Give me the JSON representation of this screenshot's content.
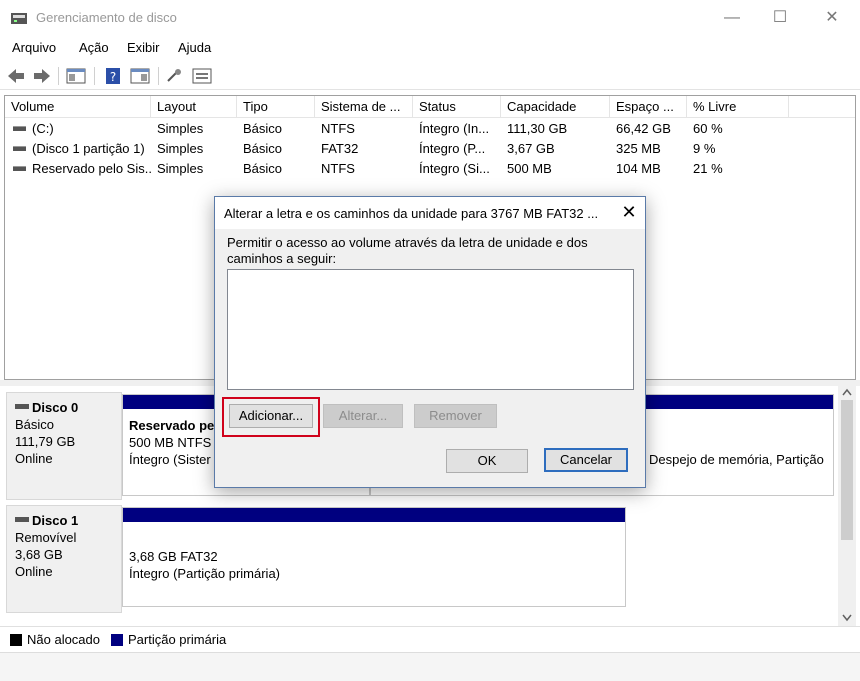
{
  "window": {
    "title": "Gerenciamento de disco",
    "minimize": "—",
    "maximize": "☐",
    "close": "✕"
  },
  "menu": [
    "Arquivo",
    "Ação",
    "Exibir",
    "Ajuda"
  ],
  "volumes": {
    "columns": [
      "Volume",
      "Layout",
      "Tipo",
      "Sistema de ...",
      "Status",
      "Capacidade",
      "Espaço ...",
      "% Livre"
    ],
    "rows": [
      [
        "(C:)",
        "Simples",
        "Básico",
        "NTFS",
        "Íntegro (In...",
        "111,30 GB",
        "66,42 GB",
        "60 %"
      ],
      [
        "(Disco 1 partição 1)",
        "Simples",
        "Básico",
        "FAT32",
        "Íntegro (P...",
        "3,67 GB",
        "325 MB",
        "9 %"
      ],
      [
        "Reservado pelo Sis...",
        "Simples",
        "Básico",
        "NTFS",
        "Íntegro (Si...",
        "500 MB",
        "104 MB",
        "21 %"
      ]
    ]
  },
  "disks": [
    {
      "name": "Disco 0",
      "type": "Básico",
      "size": "111,79 GB",
      "state": "Online",
      "partitions": [
        {
          "title": "Reservado pe",
          "line1": "500 MB NTFS",
          "line2": "Íntegro (Sister"
        },
        {
          "title": "",
          "line1": "",
          "line2": "Despejo de memória, Partição"
        }
      ]
    },
    {
      "name": "Disco 1",
      "type": "Removível",
      "size": "3,68 GB",
      "state": "Online",
      "partitions": [
        {
          "title": "",
          "line1": "3,68 GB FAT32",
          "line2": "Íntegro (Partição primária)"
        }
      ]
    }
  ],
  "legend": [
    {
      "label": "Não alocado",
      "color": "#000000"
    },
    {
      "label": "Partição primária",
      "color": "#000080"
    }
  ],
  "dialog": {
    "title": "Alterar a letra e os caminhos da unidade para 3767 MB FAT32 ...",
    "close": "✕",
    "description": "Permitir o acesso ao volume através da letra de unidade e dos caminhos a seguir:",
    "buttons": {
      "add": "Adicionar...",
      "change": "Alterar...",
      "remove": "Remover",
      "ok": "OK",
      "cancel": "Cancelar"
    }
  },
  "colors": {
    "primary_partition": "#000080",
    "highlight": "#d0021b",
    "default_button": "#2e6dbe"
  }
}
